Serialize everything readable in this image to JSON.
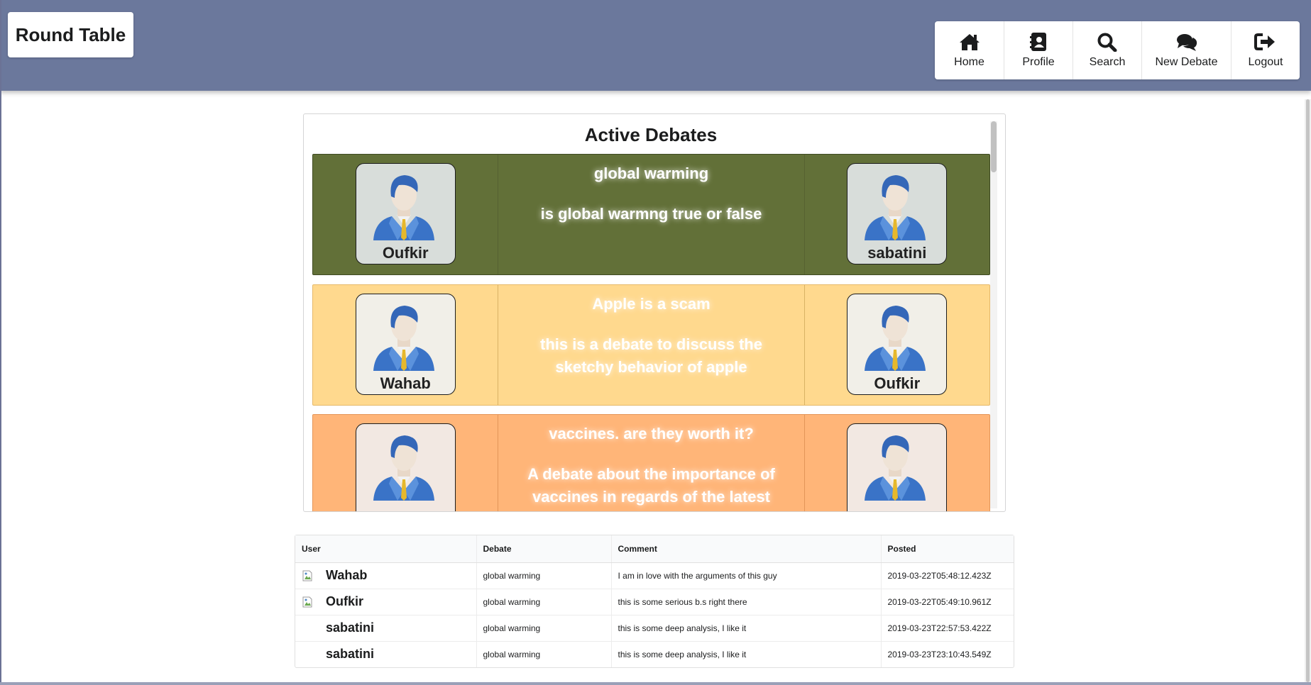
{
  "app": {
    "brand": "Round Table"
  },
  "nav": [
    {
      "label": "Home",
      "icon": "home-icon"
    },
    {
      "label": "Profile",
      "icon": "address-book-icon"
    },
    {
      "label": "Search",
      "icon": "search-icon"
    },
    {
      "label": "New Debate",
      "icon": "comments-icon"
    },
    {
      "label": "Logout",
      "icon": "sign-out-icon"
    }
  ],
  "active_debates": {
    "heading": "Active Debates",
    "debates": [
      {
        "title": "global warming",
        "description": "is global warmng true or false",
        "left_user": "Oufkir",
        "right_user": "sabatini",
        "color": "#627038"
      },
      {
        "title": "Apple is a scam",
        "description": "this is a debate to discuss the sketchy behavior of apple",
        "left_user": "Wahab",
        "right_user": "Oufkir",
        "color": "#ffd98e"
      },
      {
        "title": "vaccines. are they worth it?",
        "description": "A debate about the importance of vaccines in regards of the latest",
        "left_user": "",
        "right_user": "",
        "color": "#ffb578"
      }
    ]
  },
  "comments_table": {
    "headers": {
      "user": "User",
      "debate": "Debate",
      "comment": "Comment",
      "posted": "Posted"
    },
    "rows": [
      {
        "user": "Wahab",
        "debate": "global warming",
        "comment": "I am in love with the arguments of this guy",
        "posted": "2019-03-22T05:48:12.423Z",
        "has_image": true
      },
      {
        "user": "Oufkir",
        "debate": "global warming",
        "comment": "this is some serious b.s right there",
        "posted": "2019-03-22T05:49:10.961Z",
        "has_image": true
      },
      {
        "user": "sabatini",
        "debate": "global warming",
        "comment": "this is some deep analysis, I like it",
        "posted": "2019-03-23T22:57:53.422Z",
        "has_image": false
      },
      {
        "user": "sabatini",
        "debate": "global warming",
        "comment": "this is some deep analysis, I like it",
        "posted": "2019-03-23T23:10:43.549Z",
        "has_image": false
      }
    ]
  }
}
